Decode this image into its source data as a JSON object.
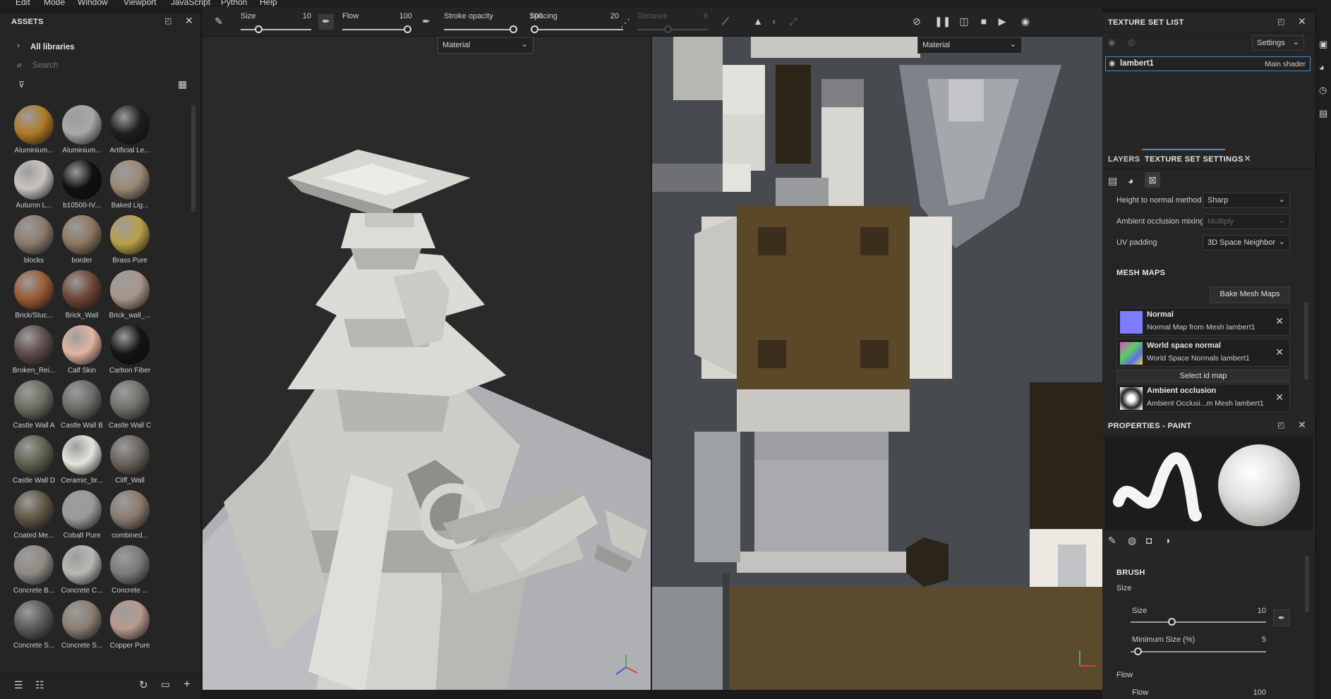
{
  "menubar": [
    "Edit",
    "Mode",
    "Window",
    "Viewport",
    "JavaScript",
    "Python",
    "Help"
  ],
  "toolbar": {
    "size_label": "Size",
    "size_value": "10",
    "size_fraction": 0.25,
    "flow_label": "Flow",
    "flow_value": "100",
    "flow_fraction": 1.0,
    "stroke_label": "Stroke opacity",
    "stroke_value": "100",
    "stroke_fraction": 1.0,
    "spacing_label": "Spacing",
    "spacing_value": "20",
    "spacing_fraction": 0.0,
    "distance_label": "Distance",
    "distance_value": "8"
  },
  "assets": {
    "title": "ASSETS",
    "all_libraries": "All libraries",
    "search_placeholder": "Search",
    "items": [
      {
        "label": "Aluminium...",
        "color": "#b07a2a"
      },
      {
        "label": "Aluminium...",
        "color": "#a8a8a8"
      },
      {
        "label": "Artificial Le...",
        "color": "#1e1e1e"
      },
      {
        "label": "Autumn L...",
        "color": "#c9c4c0"
      },
      {
        "label": "b10500-IV...",
        "color": "#101010"
      },
      {
        "label": "Baked Lig...",
        "color": "#9a8a74"
      },
      {
        "label": "blocks",
        "color": "#8a7a6a"
      },
      {
        "label": "border",
        "color": "#8c7660"
      },
      {
        "label": "Brass Pure",
        "color": "#b9a048"
      },
      {
        "label": "Brick/Stuc...",
        "color": "#9a5a34"
      },
      {
        "label": "Brick_Wall",
        "color": "#6e4636"
      },
      {
        "label": "Brick_wall_...",
        "color": "#a8968a"
      },
      {
        "label": "Broken_Rei...",
        "color": "#5e4c4c"
      },
      {
        "label": "Calf Skin",
        "color": "#e2b4a2"
      },
      {
        "label": "Carbon Fiber",
        "color": "#141414"
      },
      {
        "label": "Castle Wall A",
        "color": "#6a6c60"
      },
      {
        "label": "Castle Wall B",
        "color": "#6a6a66"
      },
      {
        "label": "Castle Wall C",
        "color": "#70706a"
      },
      {
        "label": "Castle Wall D",
        "color": "#5e624e"
      },
      {
        "label": "Ceramic_br...",
        "color": "#e4e4dc"
      },
      {
        "label": "Cliff_Wall",
        "color": "#6a625c"
      },
      {
        "label": "Coated Me...",
        "color": "#5e5644"
      },
      {
        "label": "Cobalt Pure",
        "color": "#9a9a9a"
      },
      {
        "label": "combined...",
        "color": "#8a7a6e"
      },
      {
        "label": "Concrete B...",
        "color": "#8e8a82"
      },
      {
        "label": "Concrete C...",
        "color": "#b8b8b4"
      },
      {
        "label": "Concrete ...",
        "color": "#7a7a78"
      },
      {
        "label": "Concrete S...",
        "color": "#5a5a5a"
      },
      {
        "label": "Concrete S...",
        "color": "#8a7e70"
      },
      {
        "label": "Copper Pure",
        "color": "#b89a8e"
      }
    ]
  },
  "viewport3d": {
    "dropdown": "Material"
  },
  "viewport2d": {
    "dropdown": "Material"
  },
  "texture_set_list": {
    "title": "TEXTURE SET LIST",
    "settings_label": "Settings",
    "item_name": "lambert1",
    "item_shader": "Main shader"
  },
  "texture_set_settings": {
    "tab_layers": "LAYERS",
    "tab_settings": "TEXTURE SET SETTINGS",
    "height_label": "Height to normal method",
    "height_value": "Sharp",
    "ao_label": "Ambient occlusion mixing",
    "ao_value": "Multiply",
    "uv_label": "UV padding",
    "uv_value": "3D Space Neighbor",
    "mesh_maps_title": "MESH MAPS",
    "bake_button": "Bake Mesh Maps",
    "maps": [
      {
        "title": "Normal",
        "subtitle": "Normal Map from Mesh lambert1"
      },
      {
        "title": "World space normal",
        "subtitle": "World Space Normals lambert1"
      },
      {
        "title": "Ambient occlusion",
        "subtitle": "Ambient Occlusi...m Mesh lambert1"
      }
    ],
    "select_id": "Select id map"
  },
  "properties": {
    "title": "PROPERTIES - PAINT",
    "brush_title": "BRUSH",
    "size_group": "Size",
    "size_label": "Size",
    "size_value": "10",
    "size_fraction": 0.3,
    "min_size_label": "Minimum Size (%)",
    "min_size_value": "5",
    "min_size_fraction": 0.05,
    "flow_group": "Flow",
    "flow_label": "Flow",
    "flow_value": "100"
  },
  "colors": {
    "accent": "#3d8fd6",
    "panel": "#252525",
    "viewport": "#2a2a2a"
  }
}
